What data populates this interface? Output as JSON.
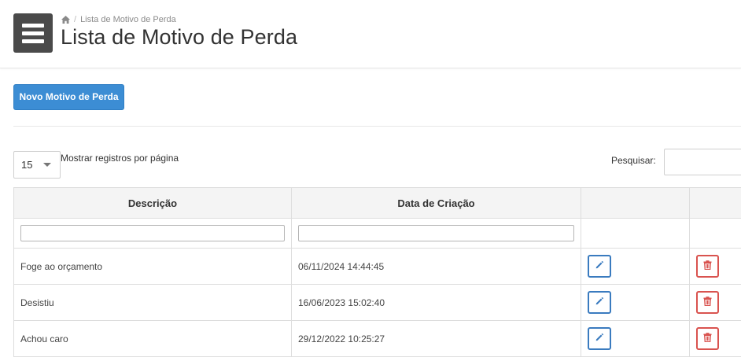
{
  "header": {
    "breadcrumb": "Lista de Motivo de Perda",
    "title": "Lista de Motivo de Perda"
  },
  "toolbar": {
    "new_label": "Novo Motivo de Perda"
  },
  "controls": {
    "page_size": "15",
    "per_page_label": "Mostrar registros por página",
    "search_label": "Pesquisar:",
    "search_value": ""
  },
  "table": {
    "columns": [
      "Descrição",
      "Data de Criação",
      "",
      ""
    ],
    "rows": [
      {
        "description": "Foge ao orçamento",
        "created": "06/11/2024 14:44:45"
      },
      {
        "description": "Desistiu",
        "created": "16/06/2023 15:02:40"
      },
      {
        "description": "Achou caro",
        "created": "29/12/2022 10:25:27"
      }
    ]
  },
  "icons": {
    "menu": "hamburger-menu-icon",
    "home": "home-icon",
    "edit": "pencil-icon",
    "delete": "trash-icon"
  },
  "colors": {
    "primary": "#3c8dd4",
    "edit": "#3a7bbf",
    "danger": "#d9534f",
    "menu_bg": "#4a4a4a"
  }
}
